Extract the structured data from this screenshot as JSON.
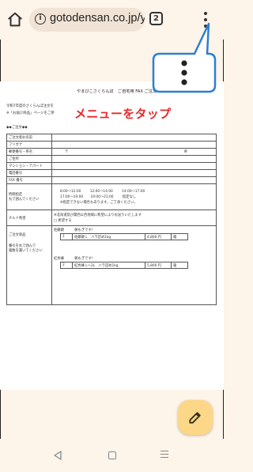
{
  "browser": {
    "url": "gotodensan.co.jp/ycher",
    "tab_count": "2",
    "info_glyph": "i"
  },
  "annotation": {
    "text": "メニューをタップ",
    "color": "#e8282a",
    "callout_border": "#2d7fd0"
  },
  "document": {
    "title": "やまびこさくらんぼ　ご自宅用 FAX ご注文　023-623-5649",
    "intro_line1": "令和7年度のさくらんぼ注文を",
    "intro_line2": "※「お届け商品」ページをご参",
    "section_heading": "◆◆ご注文◆◆",
    "rows": [
      {
        "label": "ご注文者お名前",
        "value": ""
      },
      {
        "label": "フリガナ",
        "value": ""
      },
      {
        "label": "郵便番号・県名",
        "value": "〒",
        "extra": "県"
      },
      {
        "label": "ご住所",
        "value": ""
      },
      {
        "label": "マンション・アパート",
        "value": ""
      },
      {
        "label": "電話番号",
        "value": ""
      },
      {
        "label": "FAX 番号",
        "value": ""
      }
    ],
    "time_label1": "時間指定",
    "time_label2": "丸で囲んでください",
    "time_slots": [
      "8:00～12:00",
      "12:00～14:00",
      "14:00～17:00",
      "17:00～19:00",
      "19:00～21:00",
      "指定なし"
    ],
    "time_note": "※指定できない場合もあります。ご了承ください。",
    "chilled_label": "チルド希望",
    "chilled_note": "※北海道及び関西以西地域に希望によりお送りいたします",
    "chilled_option": "□ 希望する",
    "order_label1": "ご注文商品",
    "order_label2": "番号を丸で囲んで",
    "order_label3": "箱数を書いてください",
    "products": [
      {
        "group": "佐藤錦",
        "group_note": "朝もぎです!",
        "num": "1",
        "name": "佐藤錦 L　バラ詰め1kg",
        "price": "4,800 円",
        "unit": "箱"
      },
      {
        "group": "紅秀峰",
        "group_note": "朝もぎです!",
        "num": "2",
        "name": "紅秀峰 L～2L　バラ詰め1kg",
        "price": "5,800 円",
        "unit": "箱"
      }
    ]
  },
  "icons": {
    "home": "home-icon",
    "info": "info-icon",
    "tabs": "tab-switcher-icon",
    "menu": "more-vert-icon",
    "fab": "edit-pencil-icon",
    "nav_back": "back-triangle-icon",
    "nav_home": "home-square-icon",
    "nav_recent": "recent-apps-icon"
  }
}
